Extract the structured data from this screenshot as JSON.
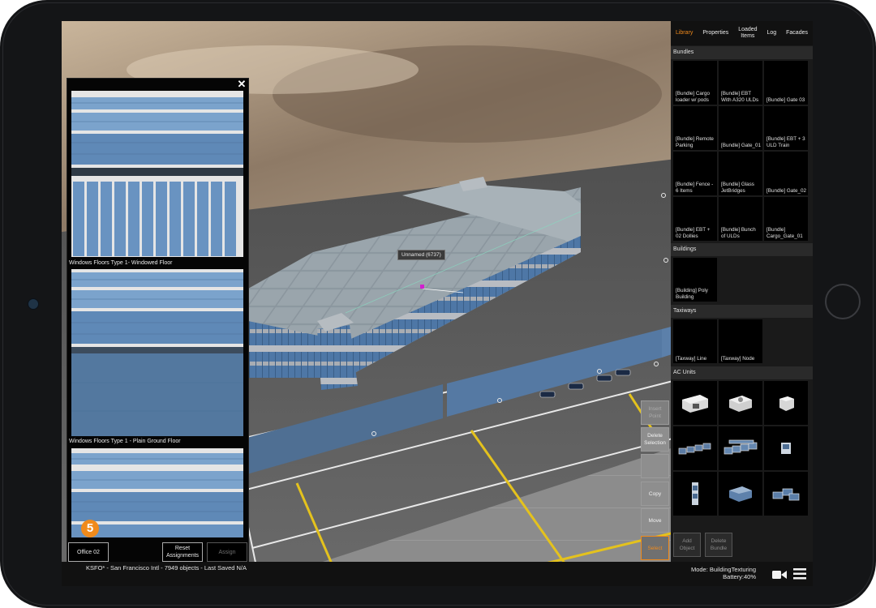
{
  "texture_panel": {
    "close_icon": "close-icon",
    "captions": [
      "Windows Floors Type 1- Windowed Floor",
      "Windows Floors Type 1 - Plain Ground Floor"
    ],
    "step_badge": "5",
    "material_button": "Office 02",
    "reset_button": "Reset\nAssignments",
    "assign_button": "Assign"
  },
  "library": {
    "tabs": [
      {
        "label": "Library",
        "active": true
      },
      {
        "label": "Properties",
        "active": false
      },
      {
        "label": "Loaded\nItems",
        "active": false
      },
      {
        "label": "Log",
        "active": false
      },
      {
        "label": "Facades",
        "active": false
      }
    ],
    "sections": {
      "bundles": {
        "title": "Bundles",
        "items": [
          "[Bundle] Cargo loader w/ pods",
          "[Bundle] EBT With A320 ULDs",
          "[Bundle] Gate 03",
          "[Bundle] Remote Parking",
          "[Bundle] Gate_01",
          "[Bundle] EBT + 3 ULD Train",
          "[Bundle] Fence - 6 Items",
          "[Bundle] Glass JetBridges",
          "[Bundle] Gate_02",
          "[Bundle] EBT + 02 Dollies",
          "[Bundle] Bunch of ULDs",
          "[Bundle] Cargo_Gate_01"
        ]
      },
      "buildings": {
        "title": "Buildings",
        "items": [
          "[Building] Poly Building"
        ]
      },
      "taxiways": {
        "title": "Taxiways",
        "items": [
          "[Taxway] Line",
          "[Taxway] Node"
        ]
      },
      "ac_units": {
        "title": "AC Units",
        "icons": [
          "ac-unit-large-icon",
          "ac-unit-medium-icon",
          "ac-unit-small-icon",
          "ac-unit-row-icon",
          "ac-unit-array-icon",
          "ac-unit-compact-icon",
          "ac-unit-tower-icon",
          "ac-unit-box-icon",
          "ac-unit-cluster-icon"
        ]
      }
    },
    "add_object_button": "Add\nObject",
    "delete_bundle_button": "Delete\nBundle"
  },
  "viewport": {
    "object_label": "Unnamed (6737)",
    "actions": {
      "insert_point": "Insert\nPoint",
      "delete_selection": "Delete\nSelection",
      "blank": "",
      "copy": "Copy",
      "move": "Move",
      "select": "Select"
    }
  },
  "status_bar": {
    "info": "KSFO* - San Francisco Intl - 7949 objects - Last Saved N/A",
    "mode": "Mode: BuildingTexturing",
    "battery": "Battery:40%",
    "camera_icon": "camera-icon",
    "menu_icon": "hamburger-menu-icon"
  },
  "colors": {
    "accent": "#f08a1b",
    "panel_bg": "#1a1a1a",
    "window_blue": "#5b86b4"
  }
}
